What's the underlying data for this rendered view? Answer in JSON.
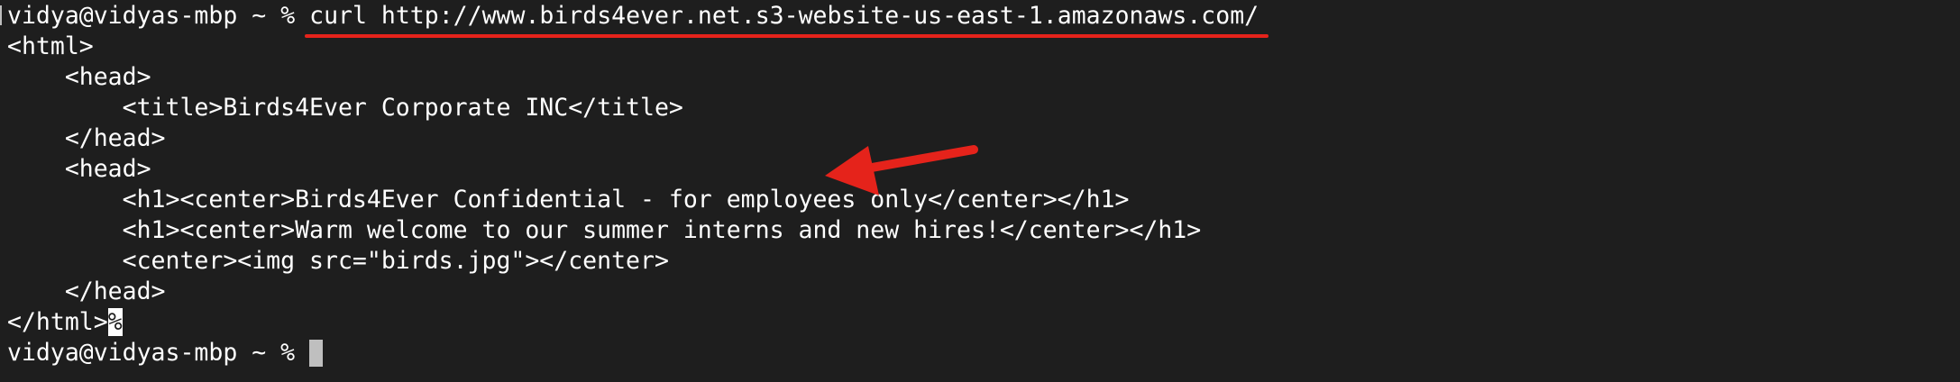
{
  "terminal": {
    "prompt_user_host": "vidya@vidyas-mbp",
    "prompt_dir": "~",
    "prompt_symbol": "%",
    "command": "curl http://www.birds4ever.net.s3-website-us-east-1.amazonaws.com/",
    "output_lines": [
      "<html>",
      "    <head>",
      "        <title>Birds4Ever Corporate INC</title>",
      "    </head>",
      "    <head>",
      "        <h1><center>Birds4Ever Confidential - for employees only</center></h1>",
      "        <h1><center>Warm welcome to our summer interns and new hires!</center></h1>",
      "        <center><img src=\"birds.jpg\"></center>",
      "    </head>"
    ],
    "last_output_text": "</html>",
    "missing_newline_marker": "%",
    "final_prompt": "vidya@vidyas-mbp ~ % "
  },
  "annotations": {
    "color": "#e5231b",
    "underline_target": "command",
    "arrow_icon": "arrow-icon"
  }
}
